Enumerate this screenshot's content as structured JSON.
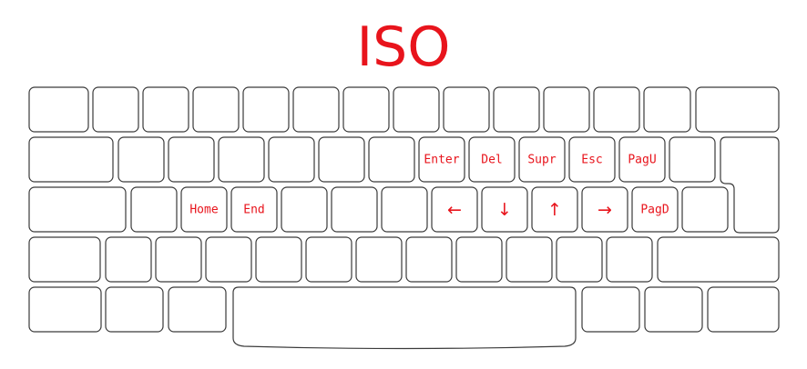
{
  "title": "ISO",
  "colors": {
    "label": "#e8141c",
    "outline": "#3a3a3a",
    "background": "#ffffff"
  },
  "keyboard": {
    "layout": "ISO",
    "labeled_keys": {
      "enter": "Enter",
      "del": "Del",
      "supr": "Supr",
      "esc": "Esc",
      "pagu": "PagU",
      "home": "Home",
      "end": "End",
      "left": "←",
      "down": "↓",
      "up": "↑",
      "right": "→",
      "pagd": "PagD"
    }
  }
}
